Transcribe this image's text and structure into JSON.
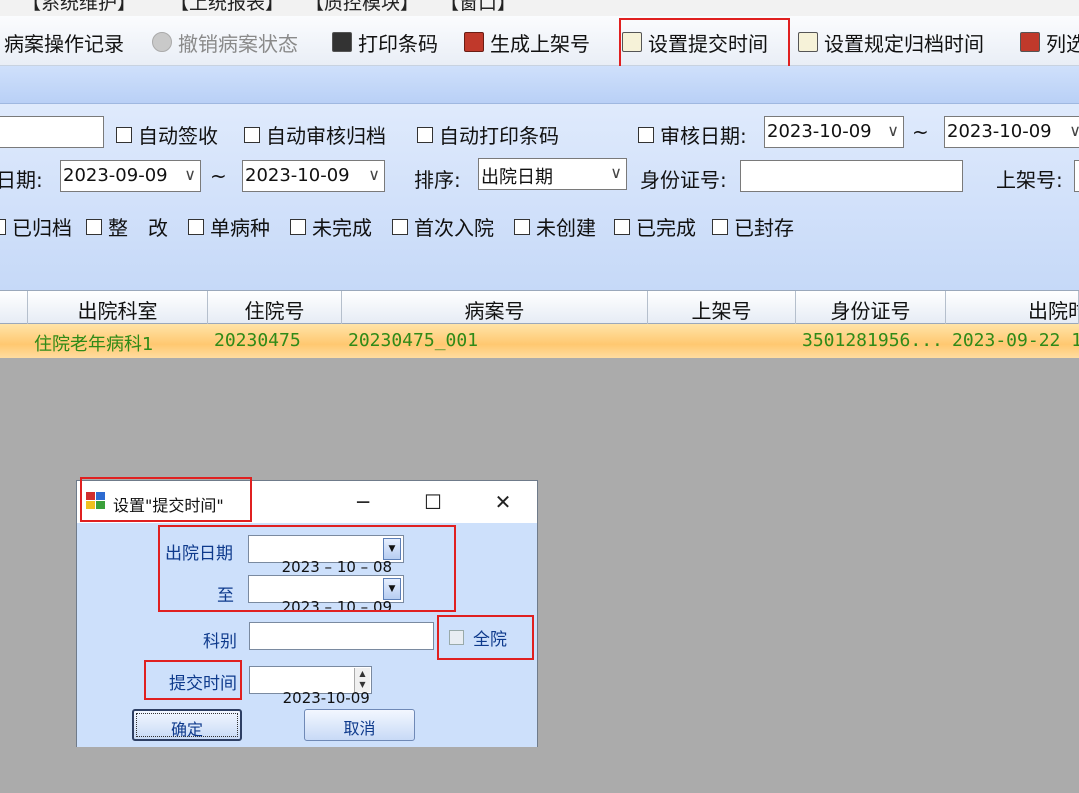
{
  "menubar": {
    "items": [
      "【系统维护】",
      "【上统报表】",
      "【质控模块】",
      "【窗口】"
    ]
  },
  "toolbar": {
    "items": [
      {
        "label": "病案操作记录",
        "icon": "none"
      },
      {
        "label": "撤销病案状态",
        "icon": "disabled-circle-icon"
      },
      {
        "label": "打印条码",
        "icon": "printer-icon"
      },
      {
        "label": "生成上架号",
        "icon": "cube-icon"
      },
      {
        "label": "设置提交时间",
        "icon": "document-icon"
      },
      {
        "label": "设置规定归档时间",
        "icon": "document-icon"
      },
      {
        "label": "列选",
        "icon": "list-icon"
      }
    ]
  },
  "filters": {
    "row1": {
      "auto_sign": "自动签收",
      "auto_review": "自动审核归档",
      "auto_print": "自动打印条码",
      "review_date_label": "审核日期:",
      "review_date_from": "2023-10-09",
      "tilde": "~",
      "review_date_to": "2023-10-09"
    },
    "row2": {
      "date_label": "日期:",
      "date_from": "2023-09-09",
      "tilde": "~",
      "date_to": "2023-10-09",
      "sort_label": "排序:",
      "sort_value": "出院日期",
      "id_label": "身份证号:",
      "shelf_label": "上架号:"
    },
    "row3": {
      "checks": [
        "已归档",
        "整　改",
        "单病种",
        "未完成",
        "首次入院",
        "未创建",
        "已完成",
        "已封存"
      ]
    }
  },
  "grid": {
    "columns": [
      "出院科室",
      "住院号",
      "病案号",
      "上架号",
      "身份证号",
      "出院时"
    ],
    "rows": [
      {
        "dept": "住院老年病科1",
        "inpatient_no": "20230475",
        "case_no": "20230475_001",
        "shelf_no": "",
        "id_no": "3501281956...",
        "discharge": "2023-09-22 1"
      }
    ]
  },
  "dialog": {
    "title": "设置\"提交时间\"",
    "minimize": "─",
    "maximize": "☐",
    "close": "✕",
    "discharge_label": "出院日期",
    "discharge_from": "2023 – 10 – 08",
    "to_label": "至",
    "discharge_to": "2023 – 10 – 09",
    "dept_label": "科别",
    "dept_value": "",
    "whole_hospital": "全院",
    "submit_label": "提交时间",
    "submit_value": "2023-10-09",
    "ok": "确定",
    "cancel": "取消"
  },
  "colors": {
    "highlight_box": "#e02020",
    "row_highlight": "#ffc870",
    "row_text": "#2f8a18",
    "dialog_label": "#0e3a8c"
  }
}
